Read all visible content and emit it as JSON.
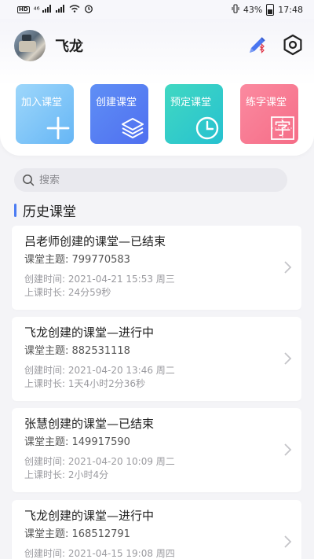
{
  "status_bar": {
    "left": "HD",
    "signal": "⁴⁶",
    "battery": "43%",
    "time": "17:48"
  },
  "profile": {
    "name": "飞龙"
  },
  "tiles": [
    {
      "label": "加入课堂",
      "icon": "plus-icon"
    },
    {
      "label": "创建课堂",
      "icon": "layers-icon"
    },
    {
      "label": "预定课堂",
      "icon": "clock-icon"
    },
    {
      "label": "练字课堂",
      "icon": "zi-char-icon",
      "glyph": "字"
    }
  ],
  "search": {
    "placeholder": "搜索"
  },
  "section": {
    "title": "历史课堂"
  },
  "classes": [
    {
      "title": "吕老师创建的课堂—已结束",
      "topic": "课堂主题: 799770583",
      "created": "创建时间: 2021-04-21 15:53 周三",
      "duration": "上课时长: 24分59秒"
    },
    {
      "title": "飞龙创建的课堂—进行中",
      "topic": "课堂主题: 882531118",
      "created": "创建时间: 2021-04-20 13:46 周二",
      "duration": "上课时长: 1天4小时2分36秒"
    },
    {
      "title": "张慧创建的课堂—已结束",
      "topic": "课堂主题: 149917590",
      "created": "创建时间: 2021-04-20 10:09 周二",
      "duration": "上课时长: 2小时4分"
    },
    {
      "title": "飞龙创建的课堂—进行中",
      "topic": "课堂主题: 168512791",
      "created": "创建时间: 2021-04-15 19:08 周四",
      "duration": ""
    }
  ],
  "colors": {
    "accent": "#4b7cf3",
    "tile_join": "#66b6f5",
    "tile_create": "#4f6ff0",
    "tile_schedule": "#26c1d0",
    "tile_writing": "#f56d87"
  }
}
